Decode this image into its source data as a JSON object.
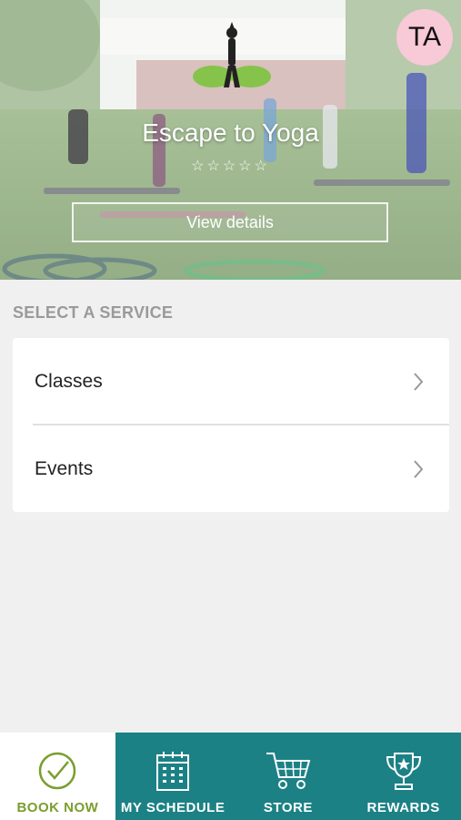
{
  "profile": {
    "initials": "TA"
  },
  "hero": {
    "studio_name": "Escape to Yoga",
    "rating_stars": "☆☆☆☆☆",
    "view_details_label": "View details"
  },
  "services": {
    "heading": "SELECT A SERVICE",
    "items": [
      {
        "label": "Classes"
      },
      {
        "label": "Events"
      }
    ]
  },
  "tabs": [
    {
      "label": "BOOK NOW",
      "icon": "check-circle-icon",
      "active": true
    },
    {
      "label": "MY SCHEDULE",
      "icon": "calendar-icon",
      "active": false
    },
    {
      "label": "STORE",
      "icon": "cart-icon",
      "active": false
    },
    {
      "label": "REWARDS",
      "icon": "trophy-icon",
      "active": false
    }
  ],
  "colors": {
    "tab_bar": "#1c8185",
    "active_tab_text": "#7a9e2d",
    "avatar_bg": "#f8c9d6"
  }
}
